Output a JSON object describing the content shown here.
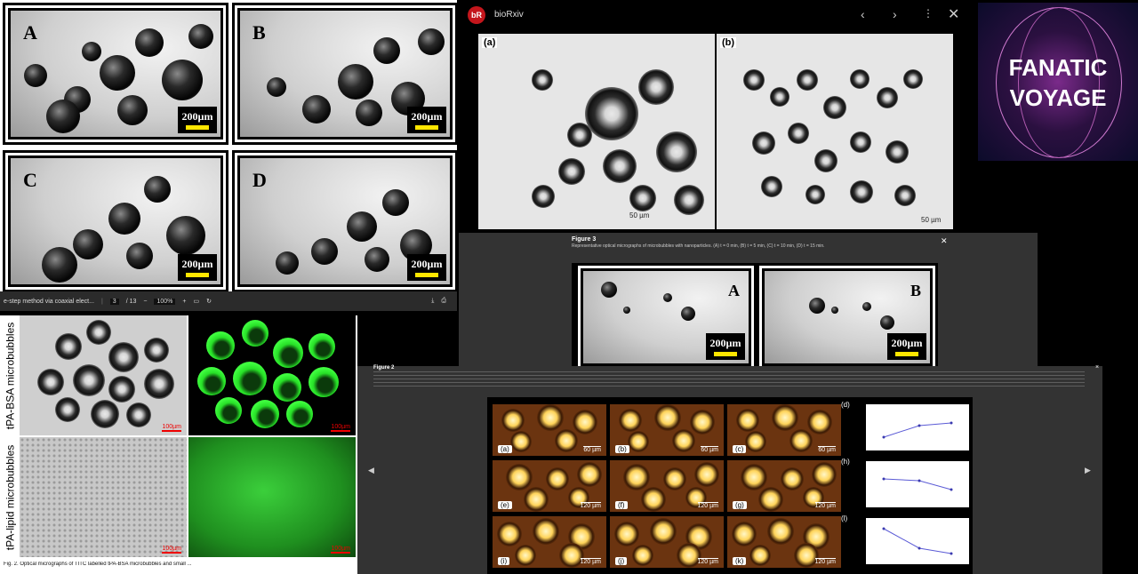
{
  "topleft": {
    "panels": [
      "A",
      "B",
      "C",
      "D"
    ],
    "scale": "200µm",
    "footer": {
      "title": "e-step method via coaxial elect...",
      "page_current": "3",
      "page_total": "/ 13",
      "zoom": "100%"
    }
  },
  "viewer": {
    "logo": "bR",
    "title": "bioRxiv",
    "labels": [
      "(a)",
      "(b)"
    ],
    "scale": "50 µm"
  },
  "ad": {
    "line1": "FANATIC",
    "line2": "VOYAGE"
  },
  "fig3": {
    "heading": "Figure 3",
    "caption": "Representative optical micrographs of microbubbles with nanoparticles. (A) t = 0 min, (B) t = 5 min, (C) t = 10 min, (D) t = 15 min.",
    "panels": [
      "A",
      "B"
    ],
    "scale": "200µm"
  },
  "leftbottom": {
    "row_labels": [
      "tPA-BSA microbubbles",
      "tPA-lipid microbubbles"
    ],
    "scale": "100µm",
    "caption": "Fig. 2. Optical micrographs of TITC labelled tPA-BSA microbubbles and small ..."
  },
  "fig2": {
    "heading": "Figure 2",
    "panels": [
      {
        "label": "(a)",
        "scale": "60 µm"
      },
      {
        "label": "(b)",
        "scale": "60 µm"
      },
      {
        "label": "(c)",
        "scale": "60 µm"
      },
      {
        "label": "(e)",
        "scale": "120 µm"
      },
      {
        "label": "(f)",
        "scale": "120 µm"
      },
      {
        "label": "(g)",
        "scale": "120 µm"
      },
      {
        "label": "(i)",
        "scale": "120 µm"
      },
      {
        "label": "(j)",
        "scale": "120 µm"
      },
      {
        "label": "(k)",
        "scale": "120 µm"
      }
    ],
    "plot_labels": [
      "(d)",
      "(h)",
      "(l)"
    ],
    "nav_prev": "◀",
    "nav_next": "▶",
    "close": "×"
  },
  "chart_data": [
    {
      "type": "line",
      "series": [
        {
          "values": [
            1.6,
            2.3,
            2.5
          ]
        }
      ]
    },
    {
      "type": "line",
      "series": [
        {
          "values": [
            2.4,
            2.3,
            1.6
          ]
        }
      ]
    },
    {
      "type": "line",
      "series": [
        {
          "values": [
            2.9,
            1.4,
            0.9
          ]
        }
      ]
    }
  ],
  "colors": {
    "scale_bar": "#ffe600",
    "bg": "#000000",
    "fluor": "#41ff41"
  }
}
